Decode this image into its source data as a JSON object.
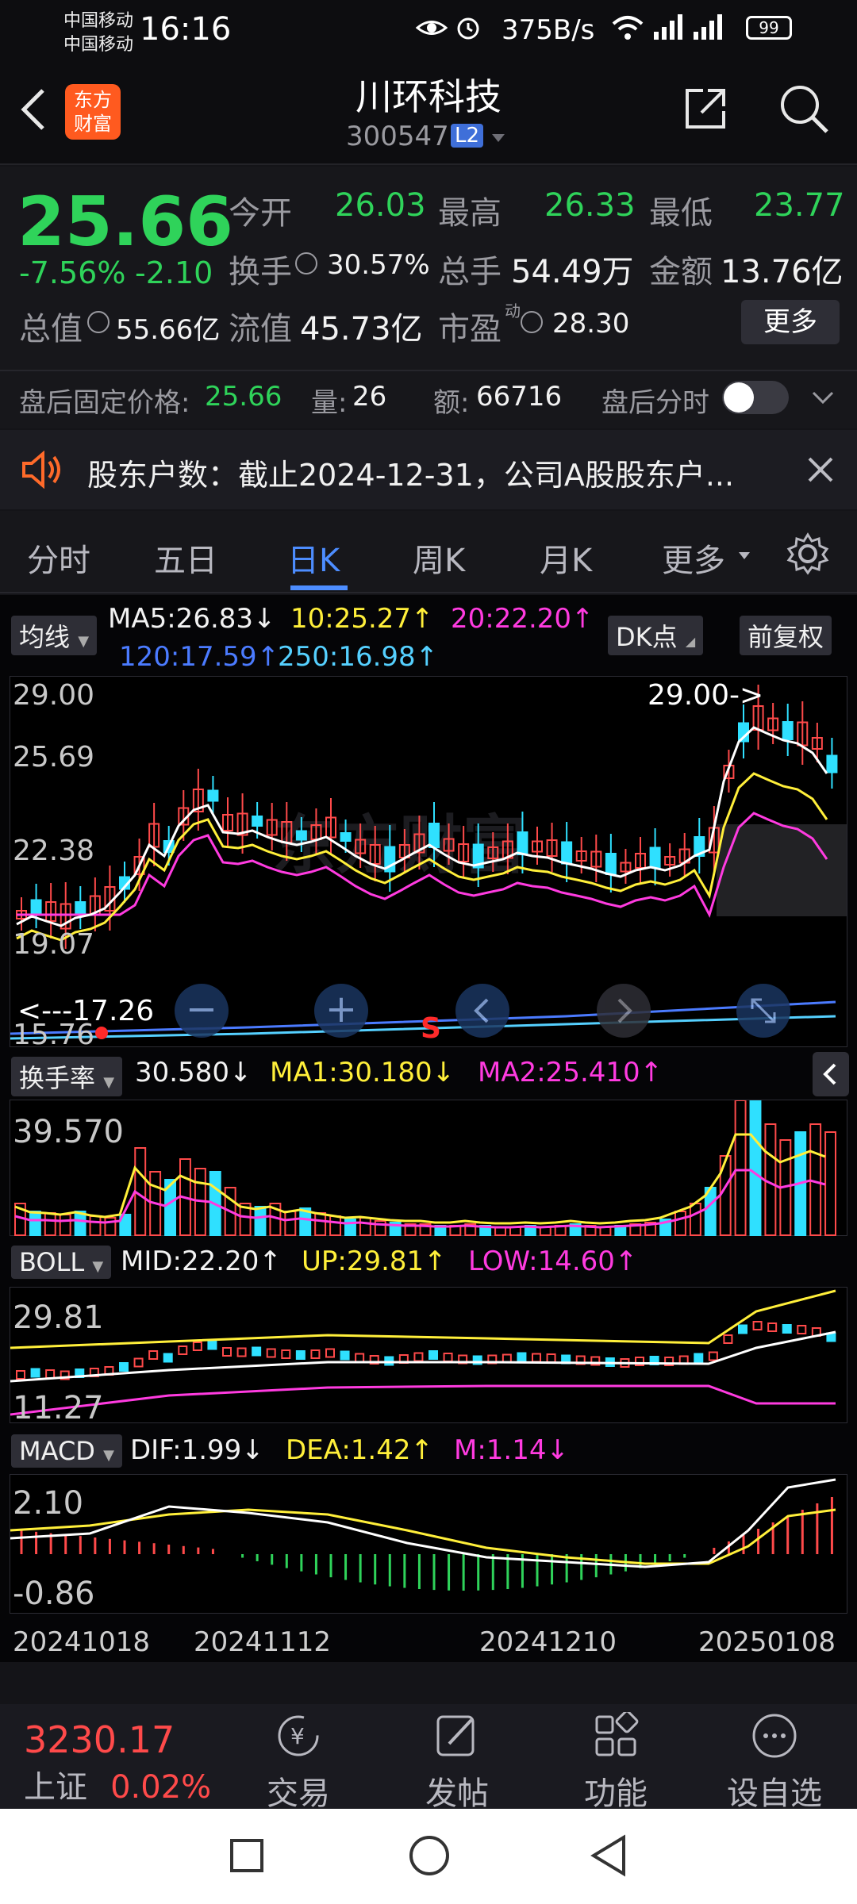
{
  "status": {
    "carrier1": "中国移动",
    "carrier2": "中国移动",
    "time": "16:16",
    "speed": "375B/s",
    "battery": "99"
  },
  "header": {
    "brand_line1": "东方",
    "brand_line2": "财富",
    "title": "川环科技",
    "code": "300547",
    "level": "L2"
  },
  "quote": {
    "price": "25.66",
    "pct": "-7.56%",
    "chg": "-2.10",
    "open_label": "今开",
    "open": "26.03",
    "high_label": "最高",
    "high": "26.33",
    "low_label": "最低",
    "low": "23.77",
    "turnover_label": "换手",
    "turnover": "30.57%",
    "volume_label": "总手",
    "volume": "54.49万",
    "amount_label": "金额",
    "amount": "13.76亿",
    "mcap_label": "总值",
    "mcap": "55.66亿",
    "float_label": "流值",
    "float": "45.73亿",
    "pe_label": "市盈",
    "pe_sup": "动",
    "pe": "28.30",
    "more": "更多",
    "after_price_label": "盘后固定价格:",
    "after_price": "25.66",
    "after_vol_label": "量:",
    "after_vol": "26",
    "after_amt_label": "额:",
    "after_amt": "66716",
    "after_timeshare": "盘后分时"
  },
  "notice": {
    "text": "股东户数：截止2024-12-31，公司A股股东户..."
  },
  "tabs": [
    "分时",
    "五日",
    "日K",
    "周K",
    "月K",
    "更多"
  ],
  "active_tab": "日K",
  "ma_bar": {
    "selector": "均线",
    "ma5": "MA5:26.83↓",
    "ma10": "10:25.27↑",
    "ma20": "20:22.20↑",
    "ma120": "120:17.59↑",
    "ma250": "250:16.98↑",
    "dk": "DK点",
    "adjust": "前复权"
  },
  "kchart": {
    "y_labels": [
      "29.00",
      "25.69",
      "22.38",
      "19.07",
      "15.76"
    ],
    "high_marker": "29.00->",
    "low_marker": "<---17.26",
    "s_marker": "S",
    "watermark": "东方财富"
  },
  "turnover_panel": {
    "selector": "换手率",
    "value": "30.580↓",
    "ma1": "MA1:30.180↓",
    "ma2": "MA2:25.410↑",
    "y_top": "39.570"
  },
  "boll_panel": {
    "selector": "BOLL",
    "mid": "MID:22.20↑",
    "up": "UP:29.81↑",
    "low": "LOW:14.60↑",
    "y_top": "29.81",
    "y_bottom": "11.27"
  },
  "macd_panel": {
    "selector": "MACD",
    "dif": "DIF:1.99↓",
    "dea": "DEA:1.42↑",
    "m": "M:1.14↓",
    "y_top": "2.10",
    "y_bottom": "-0.86"
  },
  "dates": [
    "20241018",
    "20241112",
    "20241210",
    "20250108"
  ],
  "index": {
    "value": "3230.17",
    "name": "上证",
    "pct": "0.02%"
  },
  "bottom_nav": [
    "交易",
    "发帖",
    "功能",
    "设自选"
  ],
  "colors": {
    "up": "#ff4a4a",
    "down": "#2fd35a",
    "ma5": "#ffffff",
    "ma10": "#ffef3a",
    "ma20": "#ff3be0",
    "ma120": "#4b7bff",
    "ma250": "#55d0ff",
    "accent": "#4d8dff"
  }
}
